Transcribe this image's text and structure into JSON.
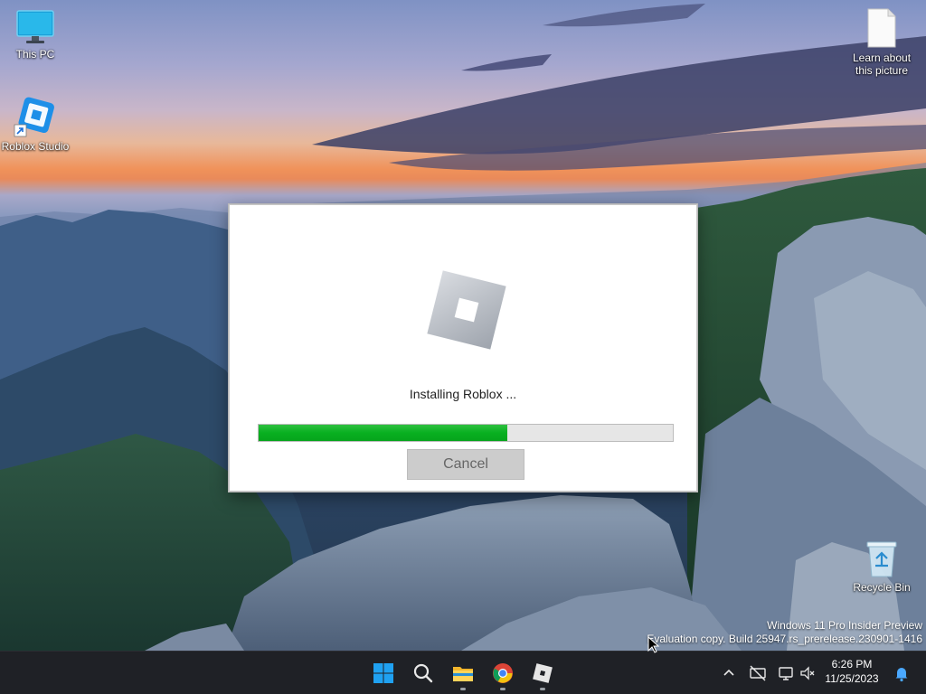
{
  "desktop": {
    "icons": [
      {
        "label": "This PC",
        "icon": "monitor-icon"
      },
      {
        "label": "Roblox Studio",
        "icon": "roblox-studio-icon"
      },
      {
        "label": "Learn about this picture",
        "icon": "document-icon"
      },
      {
        "label": "Recycle Bin",
        "icon": "recycle-bin-icon"
      }
    ],
    "watermark": {
      "line1": "Windows 11 Pro Insider Preview",
      "line2": "Evaluation copy. Build 25947.rs_prerelease.230901-1416"
    }
  },
  "installer": {
    "logo": "roblox-logo-icon",
    "status": "Installing Roblox ...",
    "progress_fraction": 0.6,
    "cancel_label": "Cancel",
    "accent_color": "#0cb322"
  },
  "taskbar": {
    "apps": [
      {
        "name": "start",
        "icon": "windows-logo-icon"
      },
      {
        "name": "search",
        "icon": "search-icon"
      },
      {
        "name": "file-explorer",
        "icon": "folder-icon"
      },
      {
        "name": "chrome",
        "icon": "chrome-icon"
      },
      {
        "name": "roblox",
        "icon": "roblox-icon"
      }
    ],
    "tray": [
      "chevron-up-icon",
      "network-off-icon",
      "display-icon",
      "volume-muted-icon",
      "notification-bell-icon"
    ],
    "clock": {
      "time": "6:26 PM",
      "date": "11/25/2023"
    }
  }
}
